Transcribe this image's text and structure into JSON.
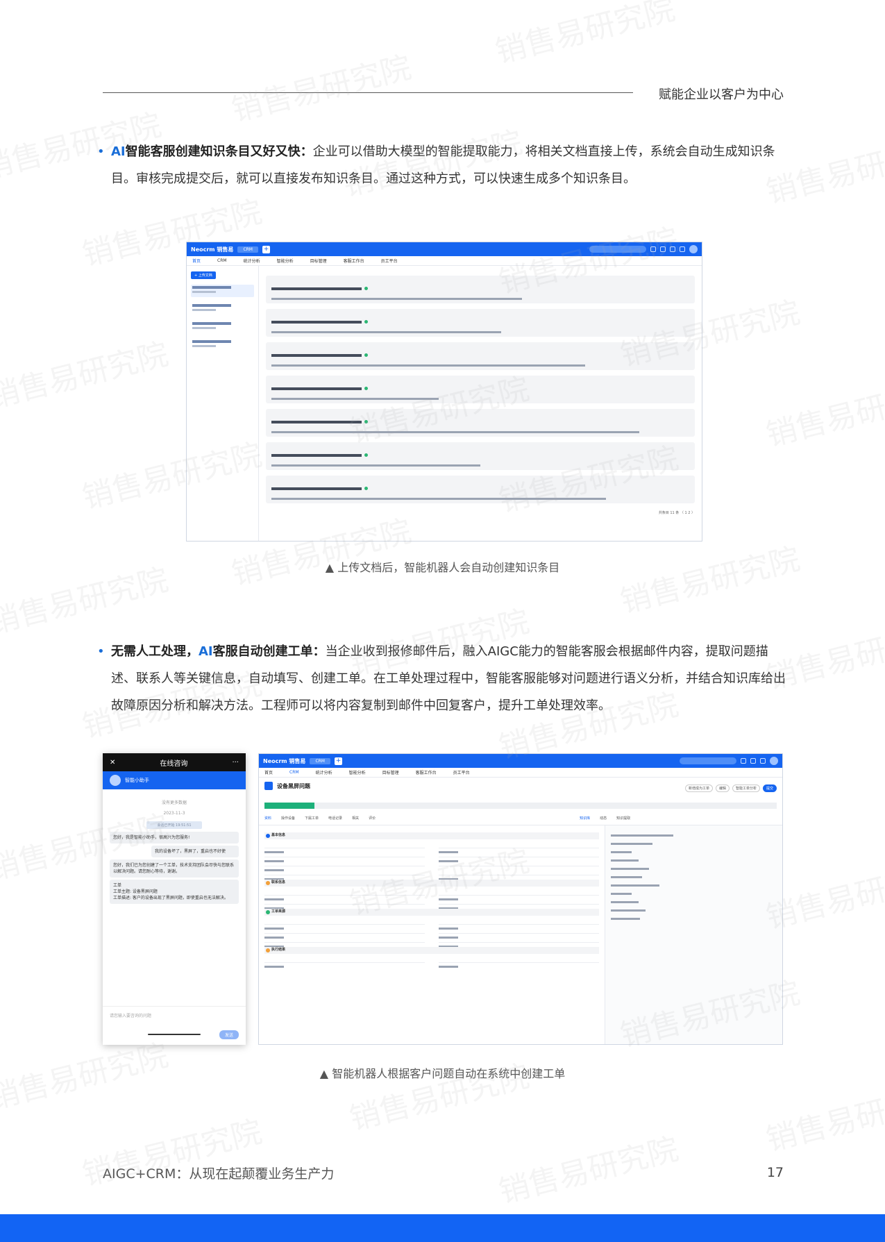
{
  "header": {
    "title": "赋能企业以客户为中心"
  },
  "section1": {
    "bullet": "•",
    "ai": "AI",
    "heading": "智能客服创建知识条目又好又快：",
    "body": "企业可以借助大模型的智能提取能力，将相关文档直接上传，系统会自动生成知识条目。审核完成提交后，就可以直接发布知识条目。通过这种方式，可以快速生成多个知识条目。",
    "caption": "▲ 上传文档后，智能机器人会自动创建知识条目"
  },
  "section2": {
    "bullet": "•",
    "heading_a": "无需人工处理，",
    "ai": "AI",
    "heading_b": "客服自动创建工单：",
    "body": "当企业收到报修邮件后，融入AIGC能力的智能客服会根据邮件内容，提取问题描述、联系人等关键信息，自动填写、创建工单。在工单处理过程中，智能客服能够对问题进行语义分析，并结合知识库给出故障原因分析和解决方法。工程师可以将内容复制到邮件中回复客户，提升工单处理效率。",
    "caption": "▲ 智能机器人根据客户问题自动在系统中创建工单"
  },
  "screenshot1": {
    "logo": "Neocrm 销售易",
    "crm_tab": "CRM",
    "nav": [
      "首页",
      "CRM",
      "统计分析",
      "智能分析",
      "目标管理",
      "客服工作台",
      "员工平台"
    ],
    "upload_button": "+ 上传文档",
    "pager": "共条目 11 条  〈 1 2 〉"
  },
  "screenshot2": {
    "chat_title": "在线咨询",
    "chat_close": "✕",
    "chat_more": "···",
    "bot_name": "智能小助手",
    "no_more": "没有更多数据",
    "date": "2023-11-3",
    "session_start": "会话已开始 19:51:51",
    "msg_bot_1": "您好，我是智能小助手，很高兴为您服务!",
    "msg_user": "我的设备坏了，黑屏了，重启也不好使",
    "msg_bot_2": "您好，我们已为您创建了一个工单，技术支持团队会尽快与您联系以解决问题。请您耐心等待，谢谢。",
    "ticket_text": "工单\n工单主题: 设备黑屏问题\n工单描述: 客户的设备出现了黑屏问题，即使重启也无法解决。",
    "input_placeholder": "请您输入要咨询的问题",
    "send": "发送",
    "ticket_title": "设备黑屏问题",
    "tabs": [
      "资料",
      "操作设备",
      "下属工单",
      "电话记录",
      "相关",
      "评价"
    ],
    "right_tabs": [
      "知识库",
      "动态",
      "知识提取"
    ],
    "sections": [
      "基本信息",
      "联系信息",
      "工单来源",
      "执行结果"
    ],
    "actions": [
      "新增成为工单",
      "编辑",
      "智能工单分析",
      "提交"
    ]
  },
  "footer": {
    "left": "AIGC+CRM：从现在起颠覆业务生产力",
    "page": "17"
  },
  "watermark": "销售易研究院",
  "colors": {
    "accent": "#1a6ed8",
    "bar": "#1264f4"
  }
}
